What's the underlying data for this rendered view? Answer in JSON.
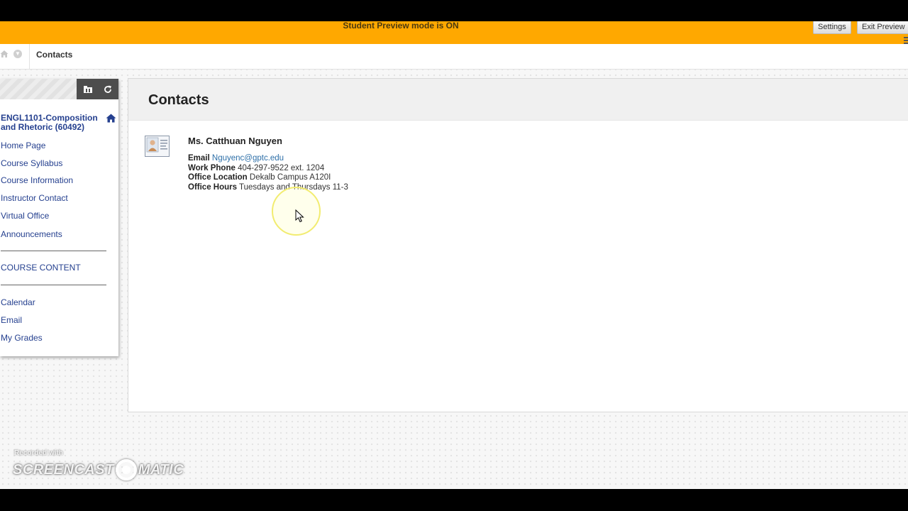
{
  "preview_banner": {
    "text": "Student Preview mode is ON",
    "settings_label": "Settings",
    "exit_label": "Exit Preview"
  },
  "breadcrumb": {
    "current": "Contacts"
  },
  "course_menu": {
    "course_title": "ENGL1101-Composition and Rhetoric (60492)",
    "items_top": [
      "Home Page",
      "Course Syllabus",
      "Course Information",
      "Instructor Contact",
      "Virtual Office",
      "Announcements"
    ],
    "section_label": "COURSE CONTENT",
    "items_bottom": [
      "Calendar",
      "Email",
      "My Grades"
    ]
  },
  "content": {
    "title": "Contacts",
    "contact": {
      "name": "Ms. Catthuan Nguyen",
      "email_label": "Email",
      "email": "Nguyenc@gptc.edu",
      "phone_label": "Work Phone",
      "phone": "404-297-9522 ext. 1204",
      "location_label": "Office Location",
      "location": "Dekalb Campus A120I",
      "hours_label": "Office Hours",
      "hours": "Tuesdays and Thursdays 11-3"
    }
  },
  "watermark": {
    "recorded": "Recorded with",
    "brand_left": "SCREENCAST",
    "brand_right": "MATIC"
  },
  "colors": {
    "banner": "#ffa800",
    "link": "#25408f",
    "email_link": "#2d6fa8"
  }
}
